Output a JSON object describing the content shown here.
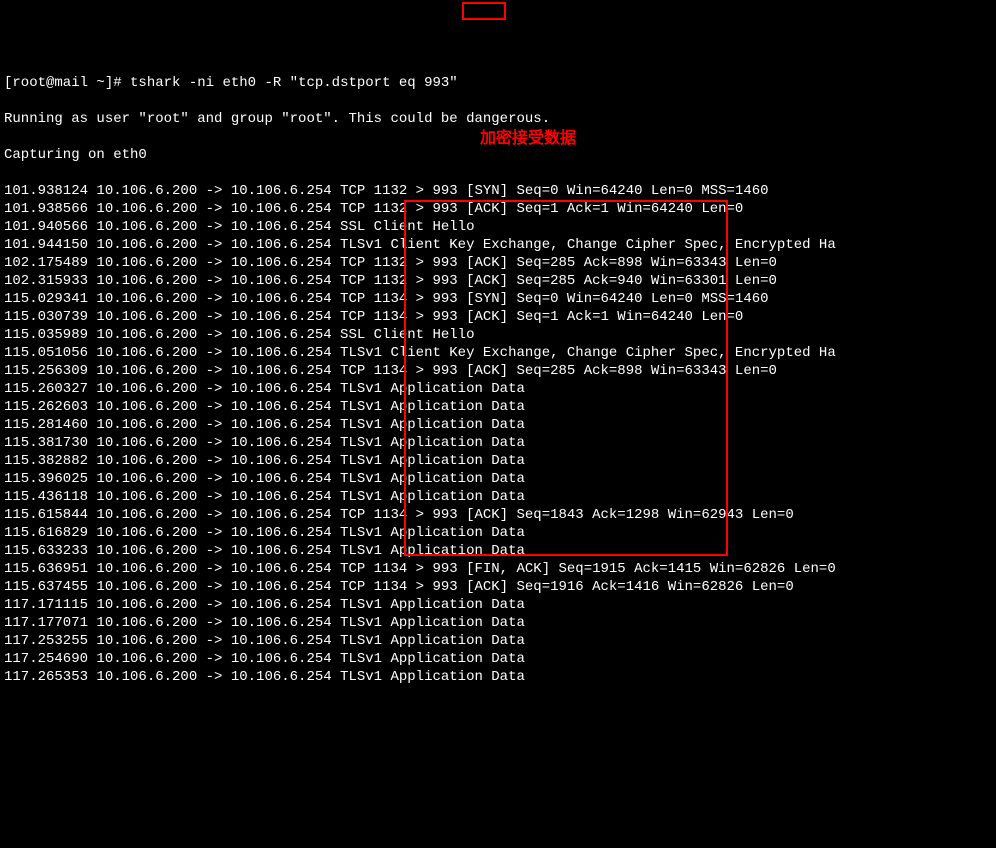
{
  "prompt": "[root@mail ~]# ",
  "command": "tshark -ni eth0 -R \"tcp.dstport eq 993\"",
  "warn": "Running as user \"root\" and group \"root\". This could be dangerous.",
  "cap": "Capturing on eth0",
  "label_red": "加密接受数据",
  "lines": [
    "101.938124 10.106.6.200 -> 10.106.6.254 TCP 1132 > 993 [SYN] Seq=0 Win=64240 Len=0 MSS=1460",
    "101.938566 10.106.6.200 -> 10.106.6.254 TCP 1132 > 993 [ACK] Seq=1 Ack=1 Win=64240 Len=0",
    "101.940566 10.106.6.200 -> 10.106.6.254 SSL Client Hello",
    "101.944150 10.106.6.200 -> 10.106.6.254 TLSv1 Client Key Exchange, Change Cipher Spec, Encrypted Ha",
    "102.175489 10.106.6.200 -> 10.106.6.254 TCP 1132 > 993 [ACK] Seq=285 Ack=898 Win=63343 Len=0",
    "102.315933 10.106.6.200 -> 10.106.6.254 TCP 1132 > 993 [ACK] Seq=285 Ack=940 Win=63301 Len=0",
    "115.029341 10.106.6.200 -> 10.106.6.254 TCP 1134 > 993 [SYN] Seq=0 Win=64240 Len=0 MSS=1460",
    "115.030739 10.106.6.200 -> 10.106.6.254 TCP 1134 > 993 [ACK] Seq=1 Ack=1 Win=64240 Len=0",
    "115.035989 10.106.6.200 -> 10.106.6.254 SSL Client Hello",
    "115.051056 10.106.6.200 -> 10.106.6.254 TLSv1 Client Key Exchange, Change Cipher Spec, Encrypted Ha",
    "115.256309 10.106.6.200 -> 10.106.6.254 TCP 1134 > 993 [ACK] Seq=285 Ack=898 Win=63343 Len=0",
    "115.260327 10.106.6.200 -> 10.106.6.254 TLSv1 Application Data",
    "115.262603 10.106.6.200 -> 10.106.6.254 TLSv1 Application Data",
    "115.281460 10.106.6.200 -> 10.106.6.254 TLSv1 Application Data",
    "115.381730 10.106.6.200 -> 10.106.6.254 TLSv1 Application Data",
    "115.382882 10.106.6.200 -> 10.106.6.254 TLSv1 Application Data",
    "115.396025 10.106.6.200 -> 10.106.6.254 TLSv1 Application Data",
    "115.436118 10.106.6.200 -> 10.106.6.254 TLSv1 Application Data",
    "115.615844 10.106.6.200 -> 10.106.6.254 TCP 1134 > 993 [ACK] Seq=1843 Ack=1298 Win=62943 Len=0",
    "115.616829 10.106.6.200 -> 10.106.6.254 TLSv1 Application Data",
    "115.633233 10.106.6.200 -> 10.106.6.254 TLSv1 Application Data",
    "115.636951 10.106.6.200 -> 10.106.6.254 TCP 1134 > 993 [FIN, ACK] Seq=1915 Ack=1415 Win=62826 Len=0",
    "115.637455 10.106.6.200 -> 10.106.6.254 TCP 1134 > 993 [ACK] Seq=1916 Ack=1416 Win=62826 Len=0",
    "117.171115 10.106.6.200 -> 10.106.6.254 TLSv1 Application Data",
    "117.177071 10.106.6.200 -> 10.106.6.254 TLSv1 Application Data",
    "117.253255 10.106.6.200 -> 10.106.6.254 TLSv1 Application Data",
    "117.254690 10.106.6.200 -> 10.106.6.254 TLSv1 Application Data",
    "117.265353 10.106.6.200 -> 10.106.6.254 TLSv1 Application Data"
  ]
}
